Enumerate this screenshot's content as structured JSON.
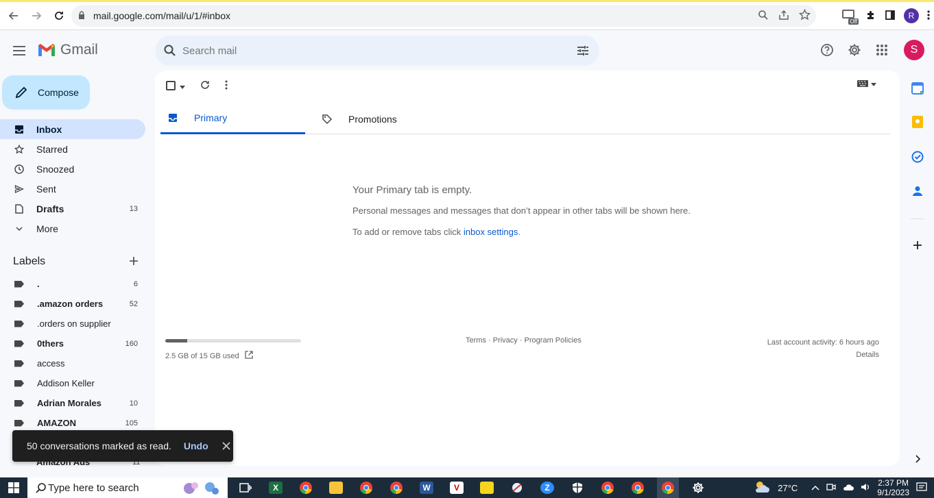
{
  "browser": {
    "url": "mail.google.com/mail/u/1/#inbox",
    "profile_initial": "R",
    "ext_off_label": "Off"
  },
  "header": {
    "app_name": "Gmail",
    "search_placeholder": "Search mail",
    "avatar_initial": "S"
  },
  "sidebar": {
    "compose_label": "Compose",
    "items": [
      {
        "label": "Inbox",
        "count": ""
      },
      {
        "label": "Starred",
        "count": ""
      },
      {
        "label": "Snoozed",
        "count": ""
      },
      {
        "label": "Sent",
        "count": ""
      },
      {
        "label": "Drafts",
        "count": "13"
      },
      {
        "label": "More",
        "count": ""
      }
    ],
    "labels_title": "Labels",
    "labels": [
      {
        "label": ".",
        "count": "6"
      },
      {
        "label": ".amazon orders",
        "count": "52"
      },
      {
        "label": ".orders on supplier",
        "count": ""
      },
      {
        "label": "0thers",
        "count": "160"
      },
      {
        "label": "access",
        "count": ""
      },
      {
        "label": "Addison Keller",
        "count": ""
      },
      {
        "label": "Adrian Morales",
        "count": "10"
      },
      {
        "label": "AMAZON",
        "count": "105"
      }
    ],
    "partial_label": "Amazon Ads",
    "partial_count": "11"
  },
  "main": {
    "tabs": [
      {
        "label": "Primary"
      },
      {
        "label": "Promotions"
      }
    ],
    "empty_title": "Your Primary tab is empty.",
    "empty_desc": "Personal messages and messages that don’t appear in other tabs will be shown here.",
    "empty_hint_prefix": "To add or remove tabs click ",
    "empty_hint_link": "inbox settings",
    "empty_hint_suffix": ".",
    "storage_text": "2.5 GB of 15 GB used",
    "storage_fraction": 0.16,
    "footer_links": "Terms · Privacy · Program Policies",
    "last_activity": "Last account activity: 6 hours ago",
    "details": "Details"
  },
  "toast": {
    "message": "50 conversations marked as read.",
    "undo": "Undo"
  },
  "taskbar": {
    "search_placeholder": "Type here to search",
    "temperature": "27°C",
    "time": "2:37 PM",
    "date": "9/1/2023"
  },
  "colors": {
    "accent": "#0b57d0",
    "compose_bg": "#c2e7ff",
    "active_nav": "#d3e3fd",
    "toast_bg": "#1f1f1f"
  }
}
